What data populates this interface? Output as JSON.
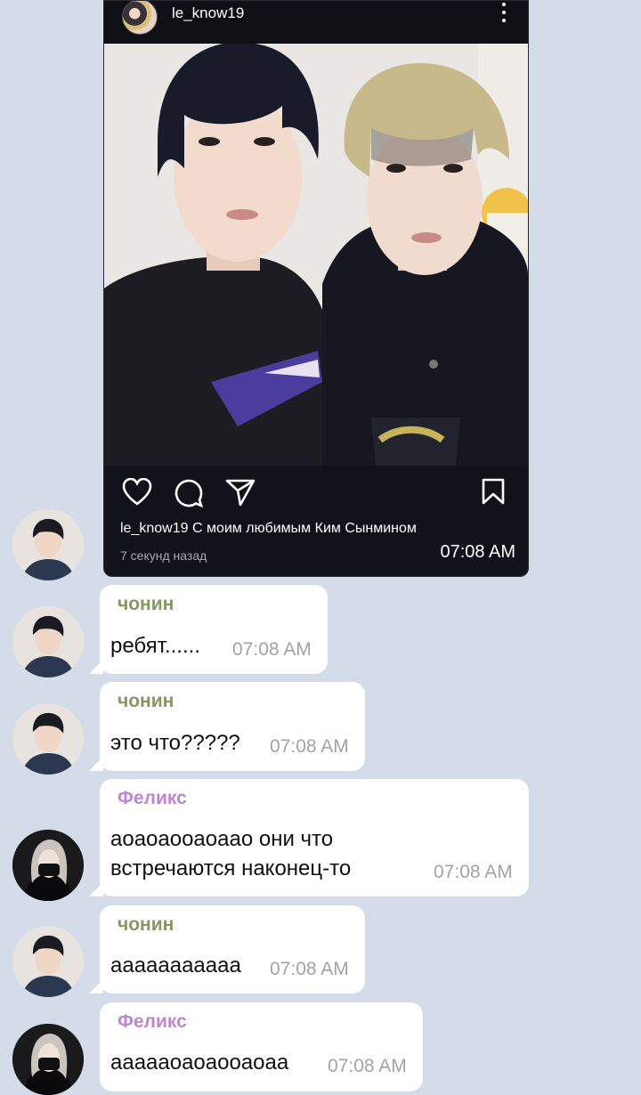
{
  "post": {
    "username": "le_know19",
    "caption_user": "le_know19",
    "caption_text": "С моим любимым Ким Сынмином",
    "time_ago": "7 секунд назад",
    "time": "07:08 AM",
    "icons": [
      "heart-icon",
      "comment-icon",
      "share-icon",
      "bookmark-icon",
      "more-icon"
    ]
  },
  "messages": [
    {
      "sender": "чонин",
      "text": "ребят......",
      "time": "07:08 AM"
    },
    {
      "sender": "чонин",
      "text": "это что?????",
      "time": "07:08 AM"
    },
    {
      "sender": "Феликс",
      "text": "аоаоаооаоаао они что",
      "text2": "встречаются  наконец-то",
      "time": "07:08 AM"
    },
    {
      "sender": "чонин",
      "text": "ааааааааааа",
      "time": "07:08 AM"
    },
    {
      "sender": "Феликс",
      "text": "аааааоаоаооаоаа",
      "time": "07:08 AM"
    }
  ],
  "colors": {
    "background": "#d4dce9",
    "jeongin_name": "#879762",
    "felix_name": "#c084d4"
  }
}
